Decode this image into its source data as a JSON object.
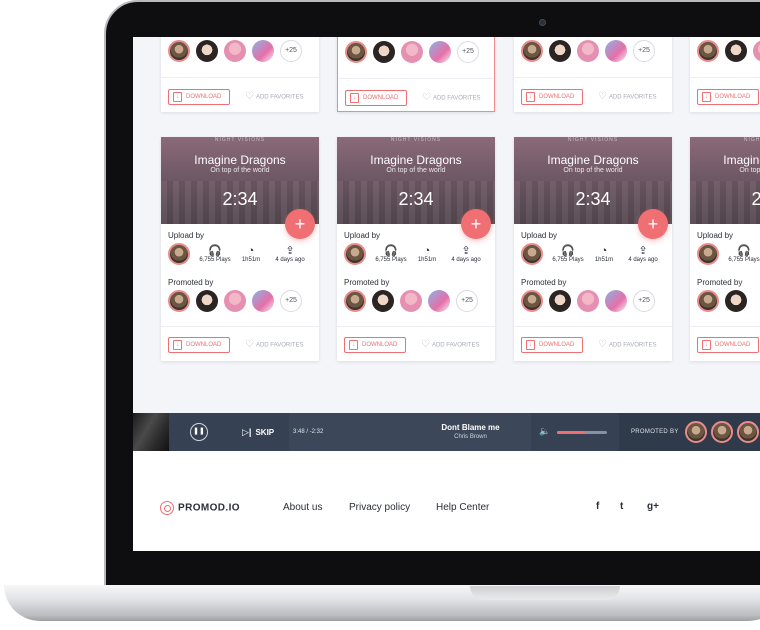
{
  "album": {
    "cover_text": "NIGHT VISIONS",
    "artist": "Imagine Dragons",
    "song": "On top of the world",
    "duration": "2:34"
  },
  "card": {
    "upload_label": "Upload by",
    "promoted_label": "Promoted by",
    "plays": "6,755 Plays",
    "length": "1h51m",
    "uploaded": "4 days ago",
    "more_count": "+25",
    "download_label": "DOWNLOAD",
    "favorites_label": "ADD FAVORITES",
    "plus_label": "+"
  },
  "player": {
    "pause_icon": "❚❚",
    "skip_label": "SKIP",
    "time": "3:48 / -2:32",
    "track_title": "Dont Blame me",
    "track_artist": "Chris Brown",
    "volume_level": 0.55,
    "promoted_by_label": "PROMOTED BY"
  },
  "footer": {
    "logo": "PROMOD.IO",
    "links": [
      "About us",
      "Privacy policy",
      "Help Center"
    ],
    "social": [
      "f",
      "t",
      "g+"
    ]
  },
  "colors": {
    "accent": "#ef6f72",
    "player_bg": "#3c4859",
    "page_bg": "#f3f5f9"
  }
}
